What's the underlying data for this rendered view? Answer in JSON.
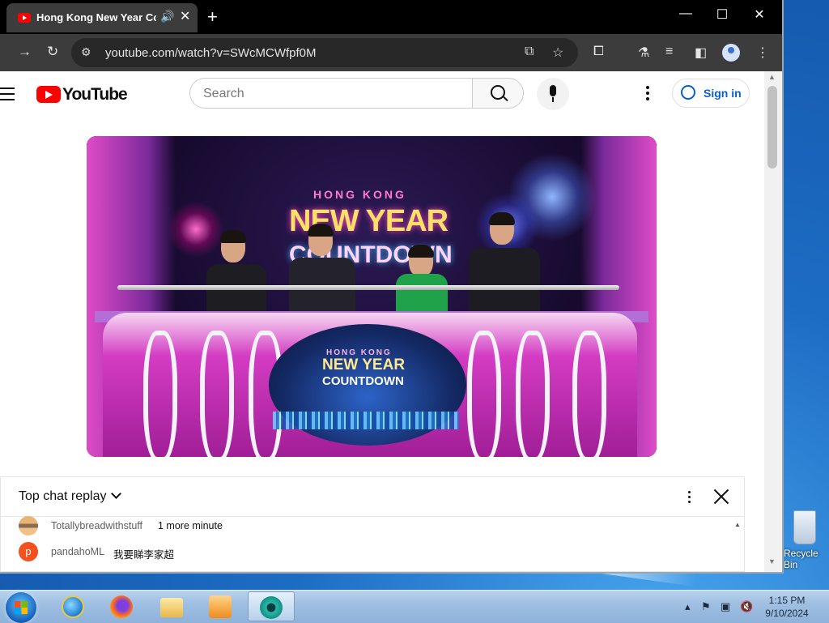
{
  "browser": {
    "tab_title": "Hong Kong New Year Countdown",
    "new_tab": "+",
    "url": "youtube.com/watch?v=SWcMCWfpf0M"
  },
  "youtube": {
    "logo_text": "YouTube",
    "search_placeholder": "Search",
    "sign_in": "Sign in"
  },
  "video": {
    "title_line1": "HONG KONG",
    "title_line2": "NEW YEAR",
    "title_line3": "COUNTDOWN",
    "screen_line1": "HONG KONG",
    "screen_line2": "NEW YEAR",
    "screen_line3": "COUNTDOWN"
  },
  "chat": {
    "header": "Top chat replay",
    "messages": [
      {
        "author": "Totallybreadwithstuff",
        "text": "1 more minute",
        "avatar_color": "#e0a45c"
      },
      {
        "author": "pandahoML",
        "text": "我要睇李家超",
        "avatar_letter": "p",
        "avatar_color": "#f4511e"
      }
    ]
  },
  "desktop": {
    "recycle_bin": "Recycle Bin"
  },
  "taskbar": {
    "time": "1:15 PM",
    "date": "9/10/2024"
  }
}
